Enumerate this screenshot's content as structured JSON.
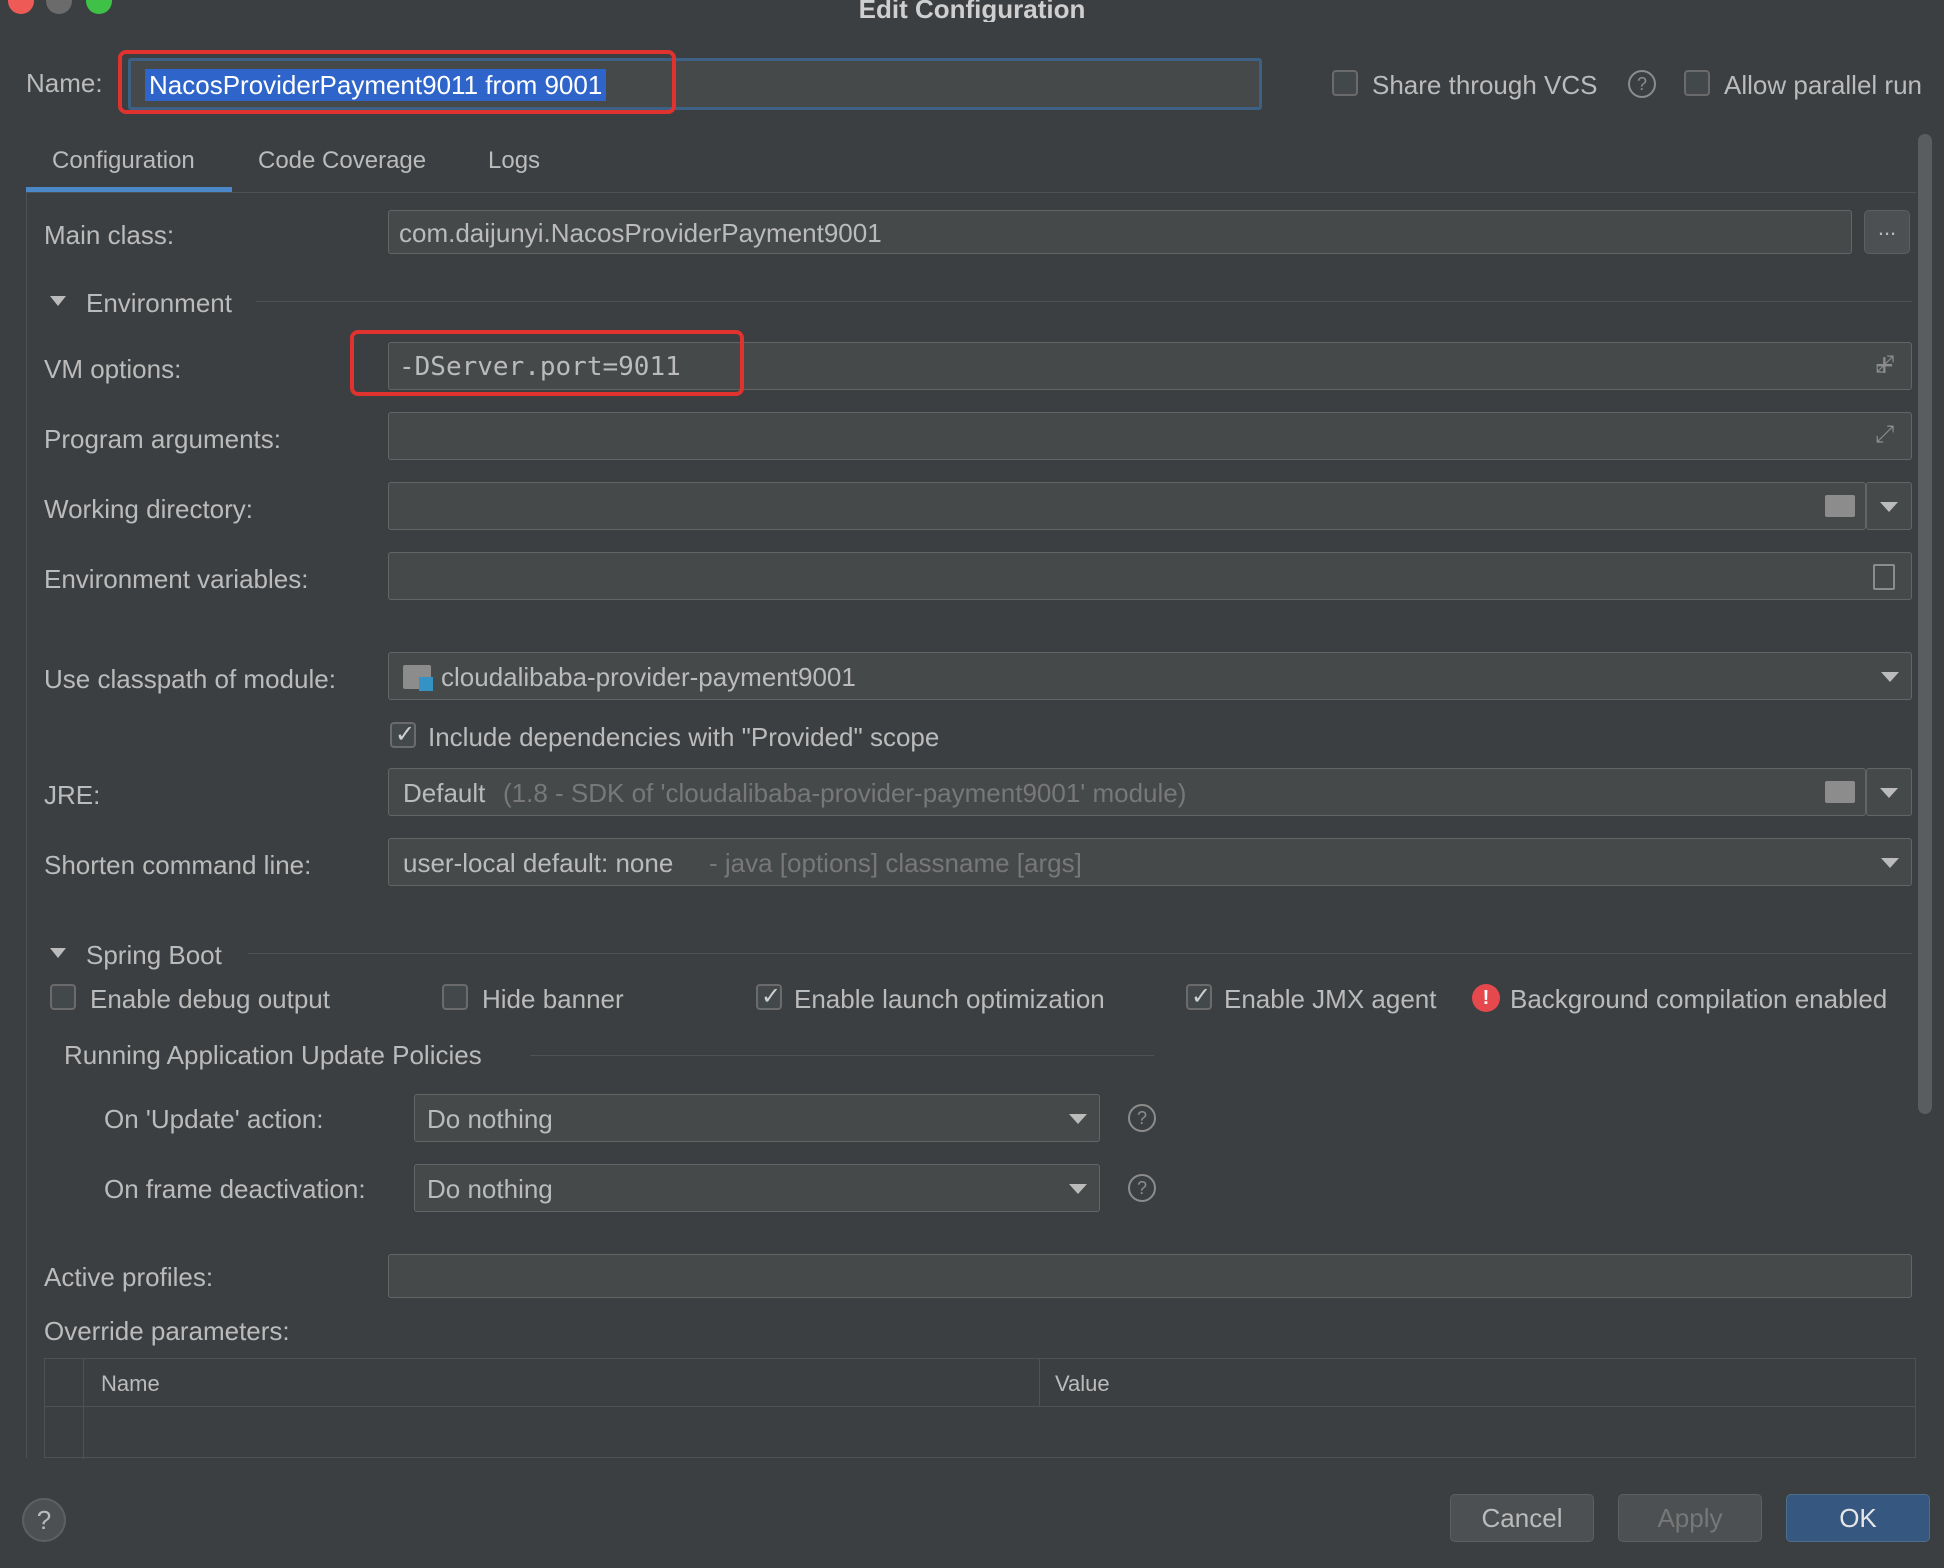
{
  "window": {
    "title": "Edit Configuration"
  },
  "header": {
    "name_label": "Name:",
    "name_value": "NacosProviderPayment9011 from 9001",
    "share_vcs_label": "Share through VCS",
    "share_vcs_help": "?",
    "allow_parallel_label": "Allow parallel run"
  },
  "tabs": [
    {
      "label": "Configuration"
    },
    {
      "label": "Code Coverage"
    },
    {
      "label": "Logs"
    }
  ],
  "form": {
    "main_class_label": "Main class:",
    "main_class_value": "com.daijunyi.NacosProviderPayment9001",
    "browse_label": "...",
    "environment_section": "Environment",
    "vm_options_label": "VM options:",
    "vm_options_value": "-DServer.port=9011",
    "program_args_label": "Program arguments:",
    "working_dir_label": "Working directory:",
    "env_vars_label": "Environment variables:",
    "classpath_label": "Use classpath of module:",
    "classpath_value": "cloudalibaba-provider-payment9001",
    "include_deps_label": "Include dependencies with \"Provided\" scope",
    "jre_label": "JRE:",
    "jre_value": "Default",
    "jre_hint": "(1.8 - SDK of 'cloudalibaba-provider-payment9001' module)",
    "shorten_label": "Shorten command line:",
    "shorten_value": "user-local default: none",
    "shorten_hint": "- java [options] classname [args]"
  },
  "spring_boot": {
    "section": "Spring Boot",
    "enable_debug_label": "Enable debug output",
    "hide_banner_label": "Hide banner",
    "launch_opt_label": "Enable launch optimization",
    "jmx_label": "Enable JMX agent",
    "bg_compilation_label": "Background compilation enabled",
    "policies_section": "Running Application Update Policies",
    "update_action_label": "On 'Update' action:",
    "update_action_value": "Do nothing",
    "frame_deact_label": "On frame deactivation:",
    "frame_deact_value": "Do nothing",
    "help": "?",
    "active_profiles_label": "Active profiles:",
    "override_label": "Override parameters:",
    "table_headers": {
      "name": "Name",
      "value": "Value"
    }
  },
  "footer": {
    "help": "?",
    "cancel": "Cancel",
    "apply": "Apply",
    "ok": "OK"
  },
  "colors": {
    "background": "#3c3f41",
    "field": "#45494a",
    "selection": "#2f65ca",
    "highlight_box": "#e0322f",
    "primary_button": "#365880"
  }
}
